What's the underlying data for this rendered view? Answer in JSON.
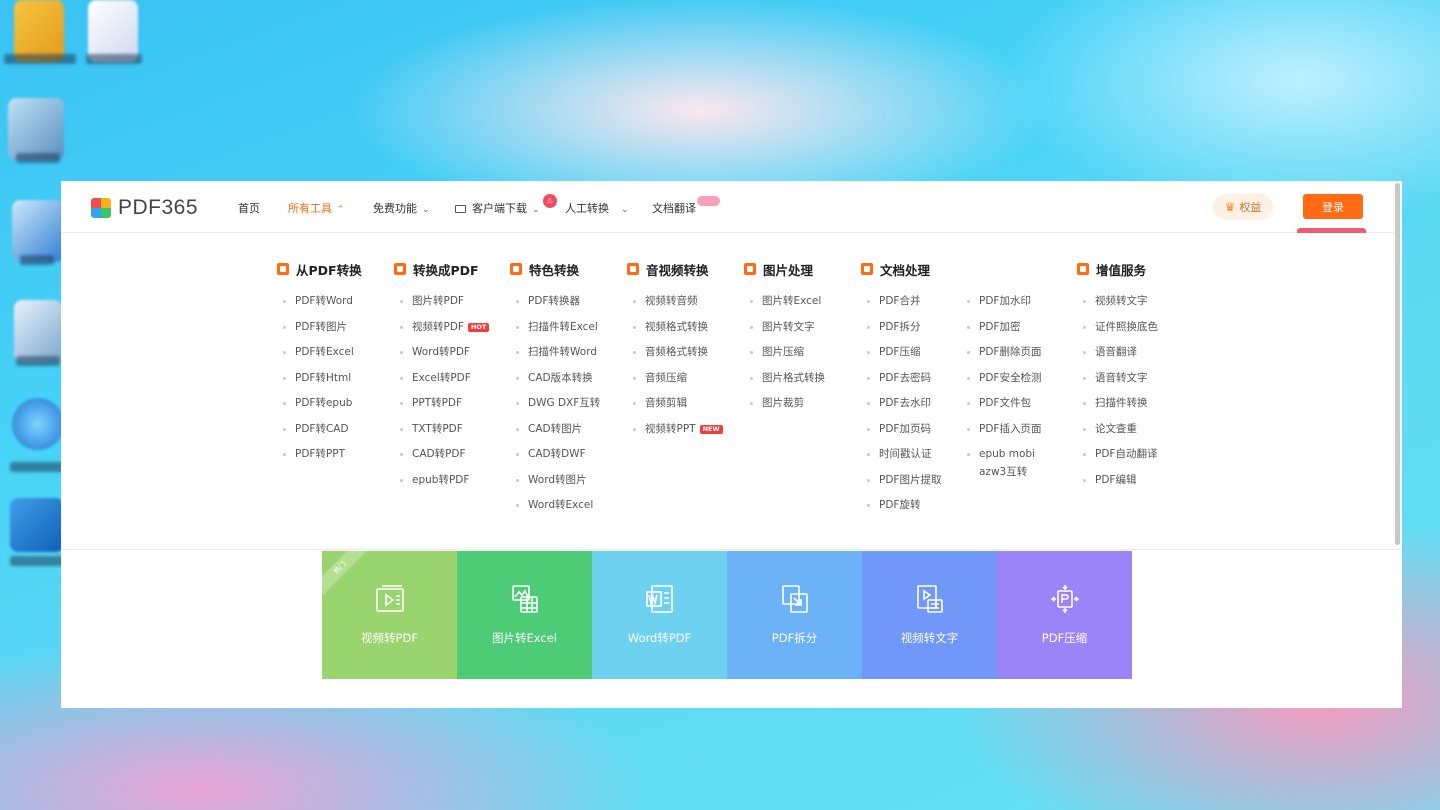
{
  "desktop": {
    "icons": [
      "user-folder-icon",
      "app-icon",
      "computer-icon",
      "network-icon",
      "recycle-bin-icon",
      "browser-icon",
      "settings-icon"
    ]
  },
  "header": {
    "logo_text": "PDF365",
    "nav": [
      {
        "label": "首页",
        "active": false
      },
      {
        "label": "所有工具",
        "active": true
      },
      {
        "label": "免费功能",
        "active": false
      },
      {
        "label": "客户端下载",
        "active": false
      },
      {
        "label": "人工转换",
        "active": false
      },
      {
        "label": "文档翻译",
        "active": false
      }
    ],
    "perk_label": "权益",
    "login_label": "登录"
  },
  "menu": {
    "columns": [
      {
        "title": "从PDF转换",
        "items": [
          "PDF转Word",
          "PDF转图片",
          "PDF转Excel",
          "PDF转Html",
          "PDF转epub",
          "PDF转CAD",
          "PDF转PPT"
        ]
      },
      {
        "title": "转换成PDF",
        "items": [
          "图片转PDF",
          "视频转PDF",
          "Word转PDF",
          "Excel转PDF",
          "PPT转PDF",
          "TXT转PDF",
          "CAD转PDF",
          "epub转PDF"
        ]
      },
      {
        "title": "特色转换",
        "items": [
          "PDF转换器",
          "扫描件转Excel",
          "扫描件转Word",
          "CAD版本转换",
          "DWG DXF互转",
          "CAD转图片",
          "CAD转DWF",
          "Word转图片",
          "Word转Excel"
        ]
      },
      {
        "title": "音视频转换",
        "items": [
          "视频转音频",
          "视频格式转换",
          "音频格式转换",
          "音频压缩",
          "音频剪辑",
          "视频转PPT"
        ]
      },
      {
        "title": "图片处理",
        "items": [
          "图片转Excel",
          "图片转文字",
          "图片压缩",
          "图片格式转换",
          "图片裁剪"
        ]
      },
      {
        "title": "文档处理",
        "items": [
          "PDF合并",
          "PDF拆分",
          "PDF压缩",
          "PDF去密码",
          "PDF去水印",
          "PDF加页码",
          "时间戳认证",
          "PDF图片提取",
          "PDF旋转"
        ]
      },
      {
        "title": "",
        "items": [
          "PDF加水印",
          "PDF加密",
          "PDF删除页面",
          "PDF安全检测",
          "PDF文件包",
          "PDF插入页面",
          "epub mobi azw3互转"
        ]
      },
      {
        "title": "增值服务",
        "items": [
          "视频转文字",
          "证件照换底色",
          "语音翻译",
          "语音转文字",
          "扫描件转换",
          "论文查重",
          "PDF自动翻译",
          "PDF编辑"
        ]
      }
    ],
    "tags": {
      "hot": "HOT",
      "new": "NEW"
    }
  },
  "tiles": {
    "ribbon": "热门",
    "items": [
      {
        "label": "视频转PDF",
        "color": "#9ad46f"
      },
      {
        "label": "图片转Excel",
        "color": "#4ecb76"
      },
      {
        "label": "Word转PDF",
        "color": "#6fd1f0"
      },
      {
        "label": "PDF拆分",
        "color": "#6bb2f7"
      },
      {
        "label": "视频转文字",
        "color": "#7197f9"
      },
      {
        "label": "PDF压缩",
        "color": "#9b84f7"
      }
    ]
  },
  "colors": {
    "accent": "#ff6a13",
    "login_tip": "#f25a6d"
  }
}
